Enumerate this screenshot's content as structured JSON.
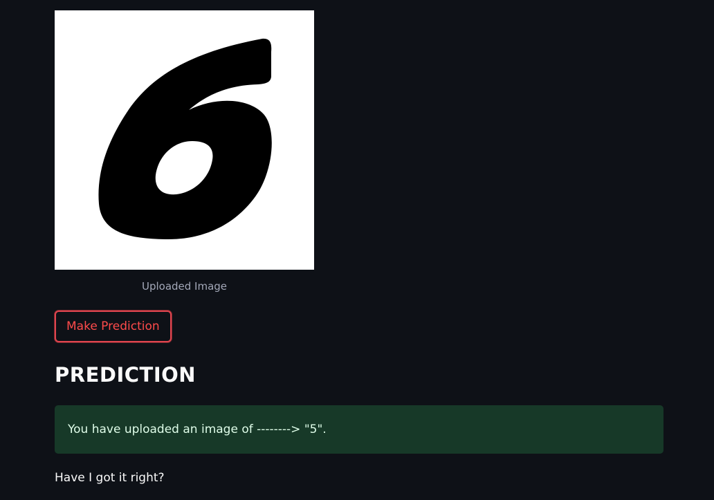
{
  "image": {
    "caption": "Uploaded Image",
    "icon": "digit-six-image"
  },
  "button": {
    "label": "Make Prediction"
  },
  "prediction": {
    "heading": "PREDICTION",
    "result_text": "You have uploaded an image of --------> \"5\"."
  },
  "question": {
    "text": "Have I got it right?"
  },
  "colors": {
    "background": "#0e1117",
    "button_accent": "#ff4b4b",
    "success_bg": "#173928",
    "success_text": "#dffde9"
  }
}
